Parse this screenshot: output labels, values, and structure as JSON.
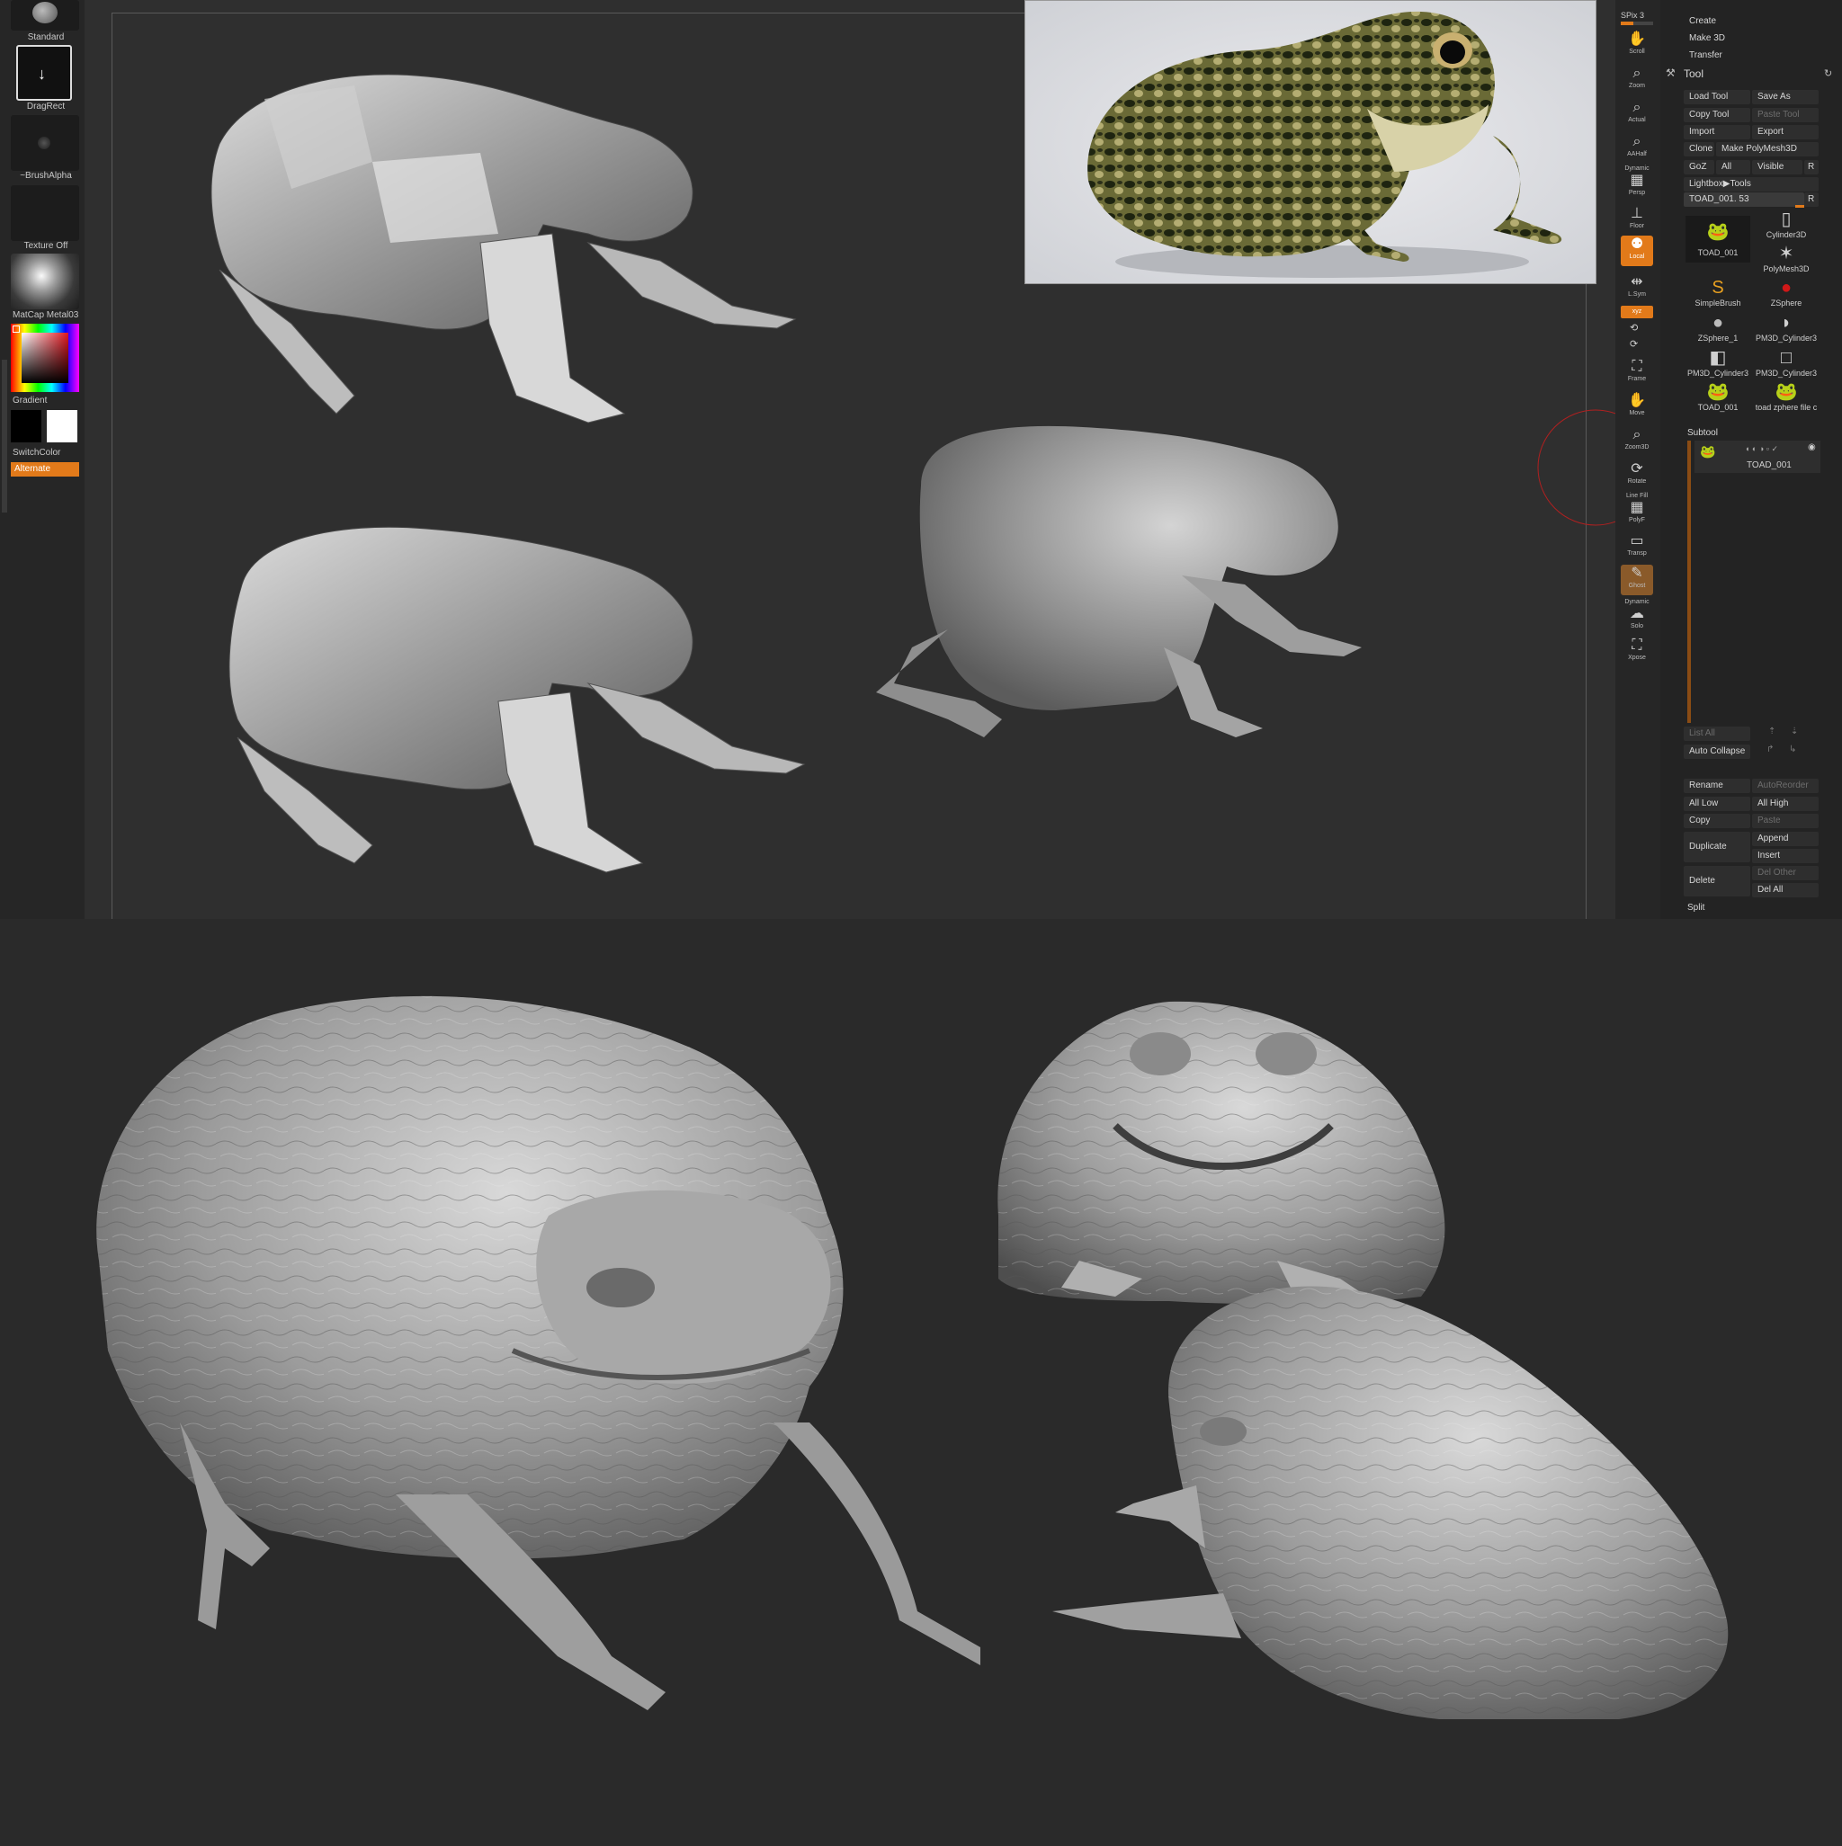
{
  "left_tray": {
    "brush_label": "Standard",
    "stroke_label": "DragRect",
    "alpha_label": "~BrushAlpha",
    "texture_label": "Texture Off",
    "material_label": "MatCap Metal03",
    "gradient_label": "Gradient",
    "switchcolor_label": "SwitchColor",
    "alternate_label": "Alternate"
  },
  "right_shelf": {
    "spix": "SPix 3",
    "buttons": [
      "Scroll",
      "Zoom",
      "Actual",
      "AAHalf",
      "Persp",
      "Floor",
      "Local",
      "L.Sym",
      "Frame",
      "Move",
      "Zoom3D",
      "Rotate",
      "PolyF",
      "Transp",
      "Ghost",
      "Solo",
      "Xpose"
    ],
    "dynamic_label": "Dynamic",
    "linefill_label": "Line Fill"
  },
  "tool_palette": {
    "top_items": [
      "Create",
      "Make 3D",
      "Transfer"
    ],
    "title": "Tool",
    "buttons": {
      "load_tool": "Load Tool",
      "save_as": "Save As",
      "copy_tool": "Copy Tool",
      "paste_tool": "Paste Tool",
      "import": "Import",
      "export": "Export",
      "clone": "Clone",
      "make_polymesh": "Make PolyMesh3D",
      "goz": "GoZ",
      "all": "All",
      "visible": "Visible",
      "r": "R",
      "lightbox": "Lightbox▶Tools"
    },
    "current_tool": "TOAD_001. 53",
    "current_r": "R",
    "thumbs": [
      "TOAD_001",
      "Cylinder3D",
      "PolyMesh3D",
      "SimpleBrush",
      "ZSphere",
      "ZSphere_1",
      "PM3D_Cylinder3",
      "PM3D_Cylinder3",
      "PM3D_Cylinder3",
      "TOAD_001",
      "toad zphere file c"
    ],
    "subtool_title": "Subtool",
    "subtool_item": "TOAD_001",
    "list_all": "List All",
    "auto_collapse": "Auto Collapse",
    "rename": "Rename",
    "autoreorder": "AutoReorder",
    "all_low": "All Low",
    "all_high": "All High",
    "copy": "Copy",
    "paste": "Paste",
    "duplicate": "Duplicate",
    "append": "Append",
    "insert": "Insert",
    "delete": "Delete",
    "del_other": "Del Other",
    "del_all": "Del All",
    "split": "Split"
  },
  "colors": {
    "accent_orange": "#e27a1a",
    "background": "#2a2a2a",
    "panel": "#232323"
  }
}
